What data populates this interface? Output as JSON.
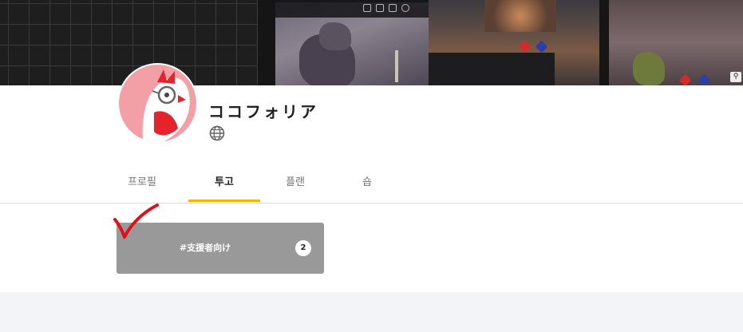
{
  "banner": {
    "label": "creator-header-image"
  },
  "profile": {
    "name": "ココフォリア",
    "avatar_icon": "owl-glasses-avatar",
    "website_icon": "globe-icon"
  },
  "tabs": [
    {
      "label": "프로필",
      "active": false
    },
    {
      "label": "투고",
      "active": true
    },
    {
      "label": "플랜",
      "active": false
    },
    {
      "label": "숍",
      "active": false
    }
  ],
  "tag_card": {
    "label": "#支援者向け",
    "count": "2"
  },
  "colors": {
    "accent_underline": "#f7b500",
    "card_bg": "#999999",
    "avatar_bg": "#f39fa6",
    "annotation_check": "#e0101a"
  }
}
